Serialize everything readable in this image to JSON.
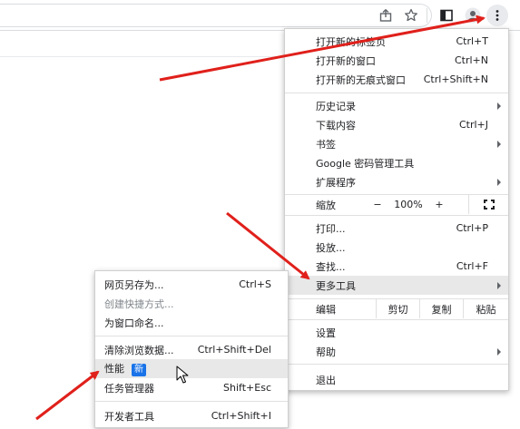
{
  "toolbar": {
    "icons": [
      "share-icon",
      "star-icon",
      "side-panel-icon",
      "profile-icon",
      "more-vert-icon"
    ]
  },
  "main_menu": {
    "new_tab": {
      "label": "打开新的标签页",
      "shortcut": "Ctrl+T"
    },
    "new_window": {
      "label": "打开新的窗口",
      "shortcut": "Ctrl+N"
    },
    "new_incognito": {
      "label": "打开新的无痕式窗口",
      "shortcut": "Ctrl+Shift+N"
    },
    "history": {
      "label": "历史记录"
    },
    "downloads": {
      "label": "下载内容",
      "shortcut": "Ctrl+J"
    },
    "bookmarks": {
      "label": "书签"
    },
    "password_manager": {
      "label": "Google 密码管理工具"
    },
    "extensions": {
      "label": "扩展程序"
    },
    "zoom": {
      "label": "缩放",
      "minus": "−",
      "value": "100%",
      "plus": "+"
    },
    "print": {
      "label": "打印...",
      "shortcut": "Ctrl+P"
    },
    "cast": {
      "label": "投放..."
    },
    "find": {
      "label": "查找...",
      "shortcut": "Ctrl+F"
    },
    "more_tools": {
      "label": "更多工具"
    },
    "edit": {
      "label": "编辑",
      "cut": "剪切",
      "copy": "复制",
      "paste": "粘贴"
    },
    "settings": {
      "label": "设置"
    },
    "help": {
      "label": "帮助"
    },
    "exit": {
      "label": "退出"
    }
  },
  "sub_menu": {
    "save_page": {
      "label": "网页另存为...",
      "shortcut": "Ctrl+S"
    },
    "create_shortcut": {
      "label": "创建快捷方式..."
    },
    "name_window": {
      "label": "为窗口命名..."
    },
    "clear_data": {
      "label": "清除浏览数据...",
      "shortcut": "Ctrl+Shift+Del"
    },
    "performance": {
      "label": "性能",
      "badge": "新"
    },
    "task_manager": {
      "label": "任务管理器",
      "shortcut": "Shift+Esc"
    },
    "devtools": {
      "label": "开发者工具",
      "shortcut": "Ctrl+Shift+I"
    }
  },
  "colors": {
    "annotation_arrow": "#e0201b",
    "badge": "#1a73e8",
    "hover_bg": "#e8e8e8"
  }
}
